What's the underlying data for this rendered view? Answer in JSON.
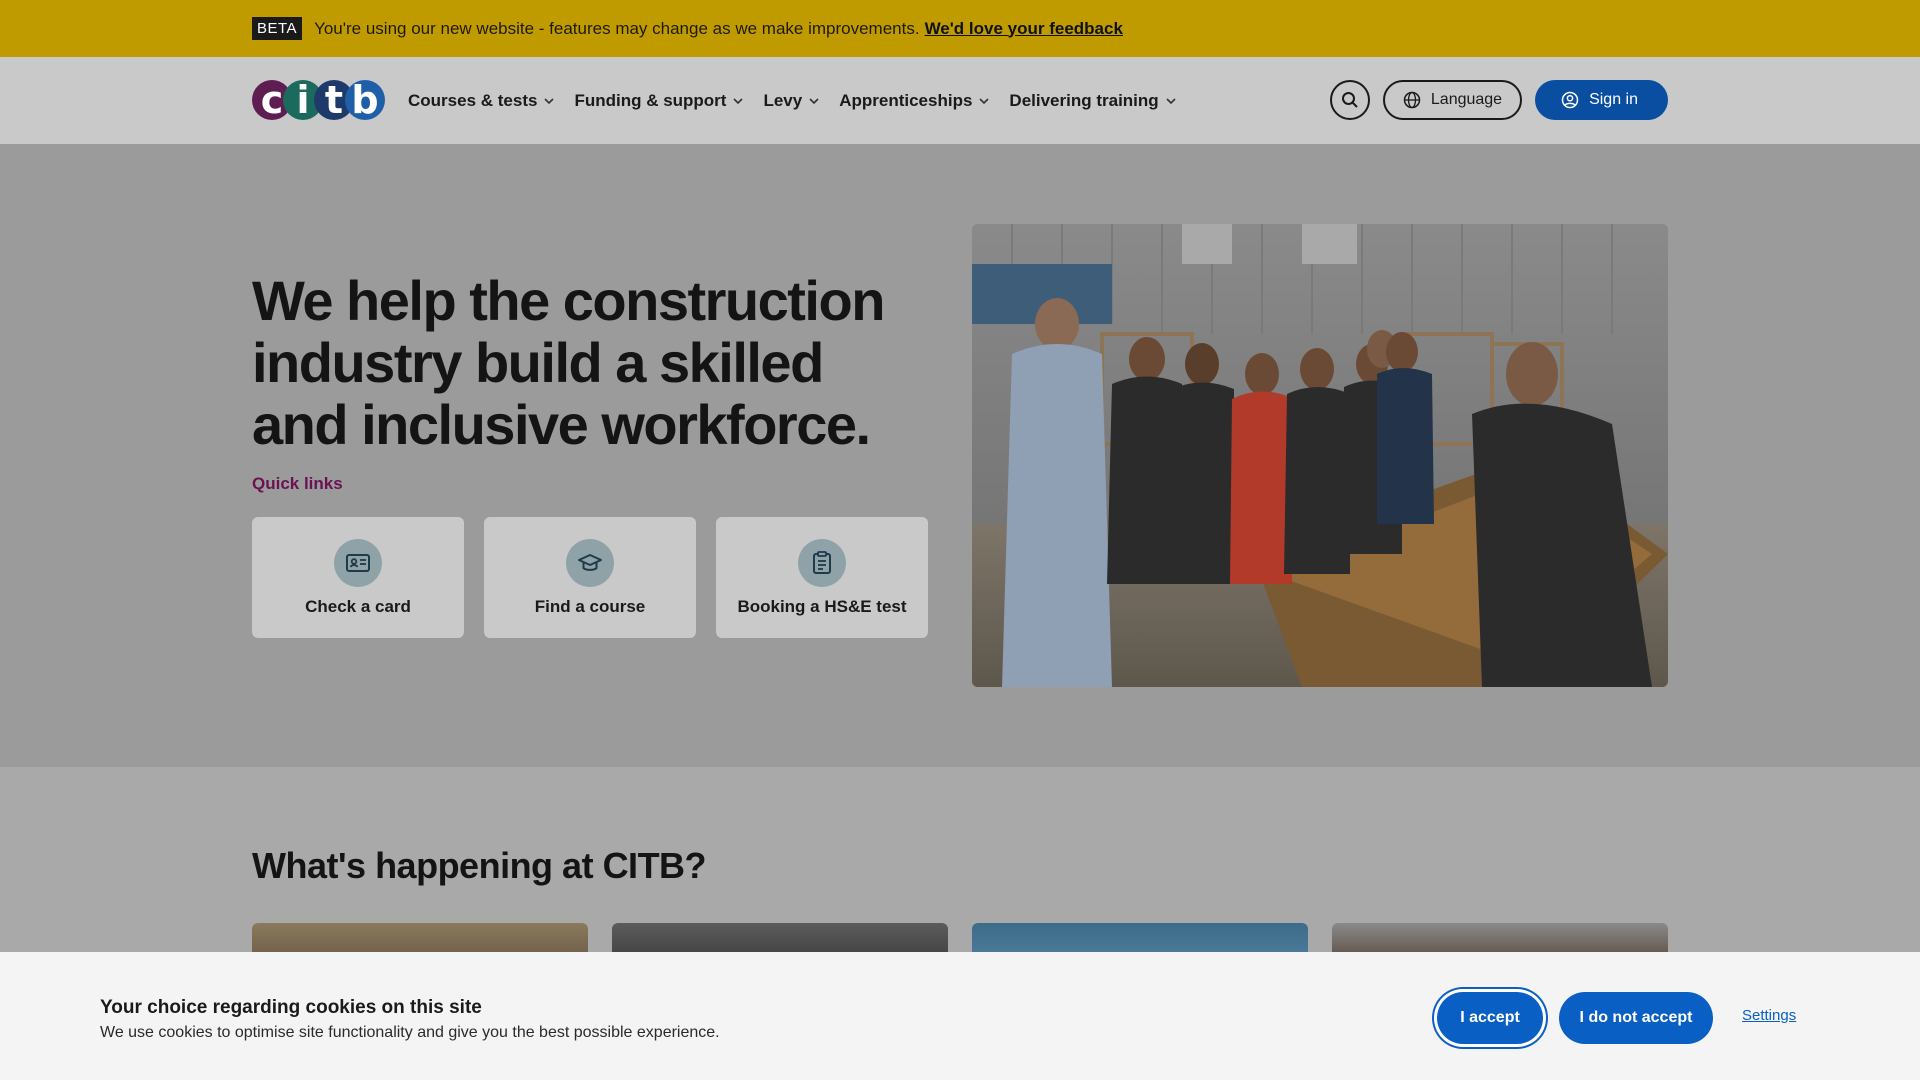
{
  "beta_banner": {
    "badge": "BETA",
    "message": "You're using our new website - features may change as we make improvements.",
    "link": "We'd love your feedback"
  },
  "header": {
    "logo_letters": [
      "c",
      "i",
      "t",
      "b"
    ],
    "nav": [
      {
        "label": "Courses & tests"
      },
      {
        "label": "Funding & support"
      },
      {
        "label": "Levy"
      },
      {
        "label": "Apprenticeships"
      },
      {
        "label": "Delivering training"
      }
    ],
    "language_label": "Language",
    "signin_label": "Sign in"
  },
  "hero": {
    "title": "We help the construction industry build a skilled and inclusive workforce.",
    "quick_links_label": "Quick links",
    "quick_links": [
      {
        "label": "Check a card",
        "icon": "id-card-icon"
      },
      {
        "label": "Find a course",
        "icon": "graduation-cap-icon"
      },
      {
        "label": "Booking a HS&E test",
        "icon": "clipboard-icon"
      }
    ]
  },
  "happening": {
    "title": "What's happening at CITB?"
  },
  "cookie_banner": {
    "title": "Your choice regarding cookies on this site",
    "text": "We use cookies to optimise site functionality and give you the best possible experience.",
    "accept_label": "I accept",
    "decline_label": "I do not accept",
    "settings_label": "Settings"
  },
  "colors": {
    "beta_bar": "#bf9b00",
    "primary_blue": "#0a5fc4",
    "brand_purple": "#6a1254"
  }
}
